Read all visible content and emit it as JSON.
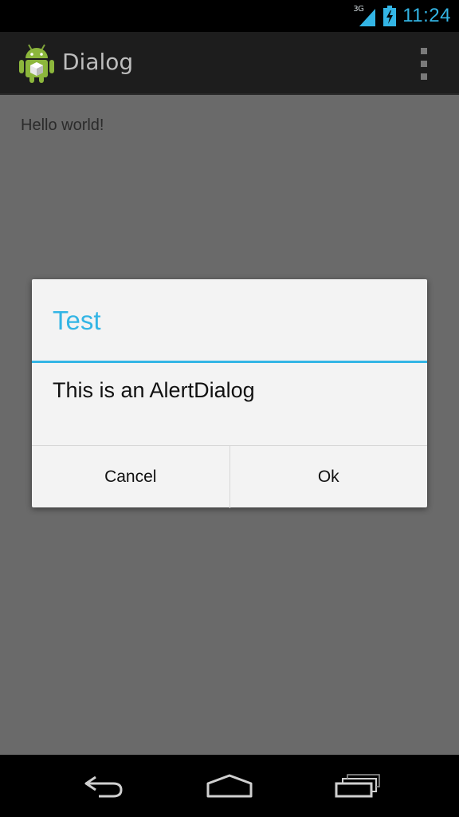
{
  "status_bar": {
    "network_label": "3G",
    "time": "11:24",
    "icons": [
      "signal-icon",
      "battery-charging-icon"
    ]
  },
  "action_bar": {
    "title": "Dialog",
    "app_icon": "android-robot-icon",
    "overflow_icon": "overflow-menu-icon"
  },
  "content": {
    "text": "Hello world!"
  },
  "dialog": {
    "title": "Test",
    "message": "This is an AlertDialog",
    "buttons": {
      "negative": "Cancel",
      "positive": "Ok"
    }
  },
  "nav_bar": {
    "icons": [
      "back-icon",
      "home-icon",
      "recent-apps-icon"
    ]
  },
  "colors": {
    "accent": "#33b5e5",
    "content_bg": "#6a6a6a",
    "dialog_bg": "#f3f3f3",
    "action_bar_bg": "#1d1d1d"
  }
}
